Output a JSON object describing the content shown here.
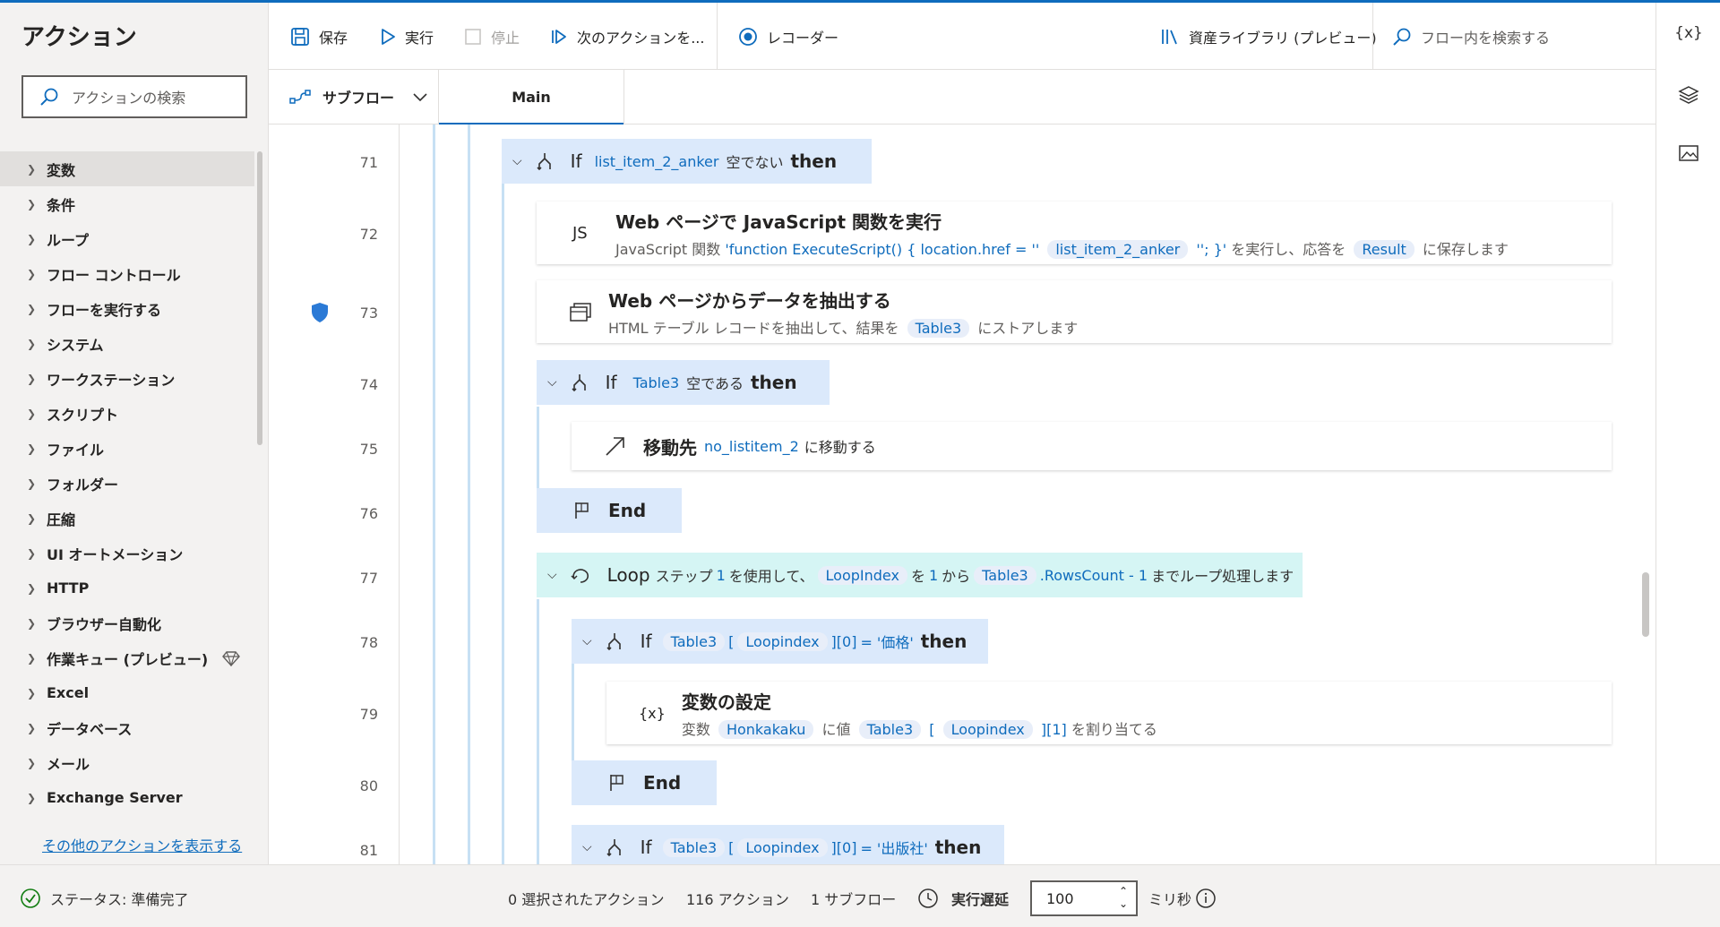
{
  "sidebar": {
    "title": "アクション",
    "search_placeholder": "アクションの検索",
    "items": [
      "変数",
      "条件",
      "ループ",
      "フロー コントロール",
      "フローを実行する",
      "システム",
      "ワークステーション",
      "スクリプト",
      "ファイル",
      "フォルダー",
      "圧縮",
      "UI オートメーション",
      "HTTP",
      "ブラウザー自動化",
      "作業キュー (プレビュー)",
      "Excel",
      "データベース",
      "メール",
      "Exchange Server"
    ],
    "more_link": "その他のアクションを表示する"
  },
  "toolbar": {
    "save": "保存",
    "run": "実行",
    "stop": "停止",
    "next": "次のアクションを...",
    "recorder": "レコーダー",
    "assets": "資産ライブラリ (プレビュー)",
    "search_placeholder": "フロー内を検索する"
  },
  "tabs": {
    "subflow": "サブフロー",
    "main": "Main"
  },
  "rightbar": {
    "variables": "{x}"
  },
  "lines": [
    "71",
    "72",
    "73",
    "74",
    "75",
    "76",
    "77",
    "78",
    "79",
    "80",
    "81"
  ],
  "flow": {
    "l71": {
      "kw": "If",
      "var": "list_item_2_anker",
      "op": "空でない",
      "then": "then"
    },
    "l72": {
      "icon": "JS",
      "title": "Web ページで JavaScript 関数を実行",
      "p1": "JavaScript 関数",
      "p2": "'function ExecuteScript() { location.href = ''",
      "v1": "list_item_2_anker",
      "p3": "''; }'",
      "p4": "を実行し、応答を",
      "v2": "Result",
      "p5": "に保存します"
    },
    "l73": {
      "title": "Web ページからデータを抽出する",
      "p1": "HTML テーブル レコードを抽出して、結果を",
      "v1": "Table3",
      "p2": "にストアします"
    },
    "l74": {
      "kw": "If",
      "var": "Table3",
      "op": "空である",
      "then": "then"
    },
    "l75": {
      "title": "移動先",
      "var": "no_listitem_2",
      "tail": "に移動する"
    },
    "l76": {
      "kw": "End"
    },
    "l77": {
      "kw": "Loop",
      "p1": "ステップ",
      "n1": "1",
      "p2": "を使用して、",
      "v1": "LoopIndex",
      "p3": "を",
      "n2": "1",
      "p4": "から",
      "v2": "Table3",
      "p5": ".RowsCount - 1",
      "p6": "までループ処理します"
    },
    "l78": {
      "kw": "If",
      "v1": "Table3",
      "b1": "[",
      "v2": "Loopindex",
      "b2": "][0]",
      "eq": "= '価格'",
      "then": "then"
    },
    "l79": {
      "icon": "{x}",
      "title": "変数の設定",
      "p1": "変数",
      "v1": "Honkakaku",
      "p2": "に値",
      "v2": "Table3",
      "b1": "[",
      "v3": "Loopindex",
      "b2": "][1]",
      "p3": "を割り当てる"
    },
    "l80": {
      "kw": "End"
    },
    "l81": {
      "kw": "If",
      "v1": "Table3",
      "b1": "[",
      "v2": "Loopindex",
      "b2": "][0]",
      "eq": "= '出版社'",
      "then": "then"
    }
  },
  "status": {
    "state": "ステータス: 準備完了",
    "selected": "0 選択されたアクション",
    "actions": "116 アクション",
    "subflows": "1 サブフロー",
    "delay_label": "実行遅延",
    "delay_value": "100",
    "unit": "ミリ秒"
  }
}
